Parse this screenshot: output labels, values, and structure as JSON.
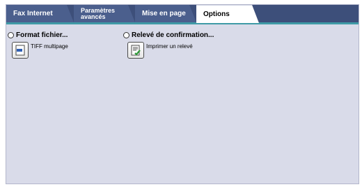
{
  "tabs": [
    {
      "label": "Fax Internet",
      "active": false
    },
    {
      "label": "Paramètres\navancés",
      "active": false
    },
    {
      "label": "Mise en page",
      "active": false
    },
    {
      "label": "Options",
      "active": true
    }
  ],
  "groups": {
    "format": {
      "title": "Format fichier...",
      "option_label": "TIFF multipage",
      "icon": "tiff-document-icon"
    },
    "report": {
      "title": "Relevé de confirmation...",
      "option_label": "Imprimer un relevé",
      "icon": "print-report-icon"
    }
  },
  "colors": {
    "tabbar": "#3d4f7a",
    "tab": "#4b5f8d",
    "accent": "#3f9aa6",
    "panel": "#d9dbe9"
  }
}
